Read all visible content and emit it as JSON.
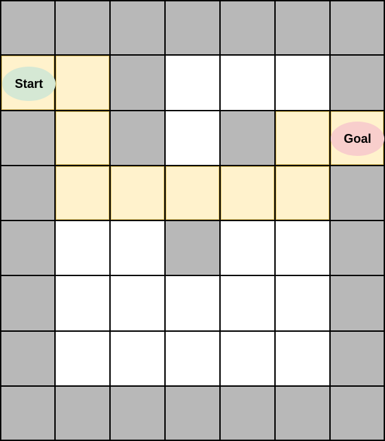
{
  "maze": {
    "rows": 8,
    "cols": 7,
    "legend": [
      "wall",
      "open",
      "path"
    ],
    "grid": [
      [
        "wall",
        "wall",
        "wall",
        "wall",
        "wall",
        "wall",
        "wall"
      ],
      [
        "path",
        "path",
        "wall",
        "open",
        "open",
        "open",
        "wall"
      ],
      [
        "wall",
        "path",
        "wall",
        "open",
        "wall",
        "path",
        "path"
      ],
      [
        "wall",
        "path",
        "path",
        "path",
        "path",
        "path",
        "wall"
      ],
      [
        "wall",
        "open",
        "open",
        "wall",
        "open",
        "open",
        "wall"
      ],
      [
        "wall",
        "open",
        "open",
        "open",
        "open",
        "open",
        "wall"
      ],
      [
        "wall",
        "open",
        "open",
        "open",
        "open",
        "open",
        "wall"
      ],
      [
        "wall",
        "wall",
        "wall",
        "wall",
        "wall",
        "wall",
        "wall"
      ]
    ],
    "start": {
      "label": "Start",
      "row": 1,
      "col": 0,
      "color": "#d5e8d4"
    },
    "goal": {
      "label": "Goal",
      "row": 2,
      "col": 6,
      "color": "#f8cecc"
    }
  },
  "colors": {
    "wall": "#b8b8b8",
    "open": "#ffffff",
    "path_fill": "#fff2cc",
    "path_border": "#d6b656",
    "grid_line": "#000000"
  }
}
